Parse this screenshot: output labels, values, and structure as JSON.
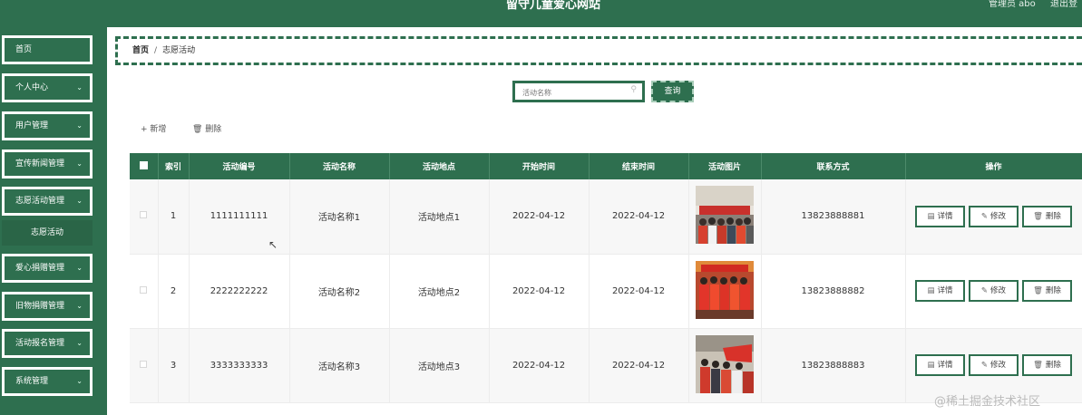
{
  "header": {
    "title": "留守儿童爱心网站",
    "admin": "管理员 abo",
    "logout": "退出登"
  },
  "sidebar": {
    "items": [
      {
        "label": "首页",
        "has_chevron": false
      },
      {
        "label": "个人中心",
        "has_chevron": true
      },
      {
        "label": "用户管理",
        "has_chevron": true
      },
      {
        "label": "宣传新闻管理",
        "has_chevron": true
      },
      {
        "label": "志愿活动管理",
        "has_chevron": true
      },
      {
        "label": "爱心捐赠管理",
        "has_chevron": true
      },
      {
        "label": "旧物捐赠管理",
        "has_chevron": true
      },
      {
        "label": "活动报名管理",
        "has_chevron": true
      },
      {
        "label": "系统管理",
        "has_chevron": true
      }
    ],
    "sub_active": "志愿活动"
  },
  "breadcrumb": {
    "home": "首页",
    "separator": "/",
    "current": "志愿活动"
  },
  "search": {
    "placeholder": "活动名称",
    "button": "查询"
  },
  "actions": {
    "add": "新增",
    "delete": "删除"
  },
  "table": {
    "headers": [
      "",
      "索引",
      "活动编号",
      "活动名称",
      "活动地点",
      "开始时间",
      "结束时间",
      "活动图片",
      "联系方式",
      "操作"
    ],
    "rows": [
      {
        "index": "1",
        "code": "1111111111",
        "name": "活动名称1",
        "place": "活动地点1",
        "start": "2022-04-12",
        "end": "2022-04-12",
        "phone": "13823888881"
      },
      {
        "index": "2",
        "code": "2222222222",
        "name": "活动名称2",
        "place": "活动地点2",
        "start": "2022-04-12",
        "end": "2022-04-12",
        "phone": "13823888882"
      },
      {
        "index": "3",
        "code": "3333333333",
        "name": "活动名称3",
        "place": "活动地点3",
        "start": "2022-04-12",
        "end": "2022-04-12",
        "phone": "13823888883"
      }
    ],
    "ops": {
      "detail": "详情",
      "edit": "修改",
      "delete": "删除"
    }
  },
  "watermark": "@稀土掘金技术社区",
  "colors": {
    "primary": "#2e6f4f"
  }
}
